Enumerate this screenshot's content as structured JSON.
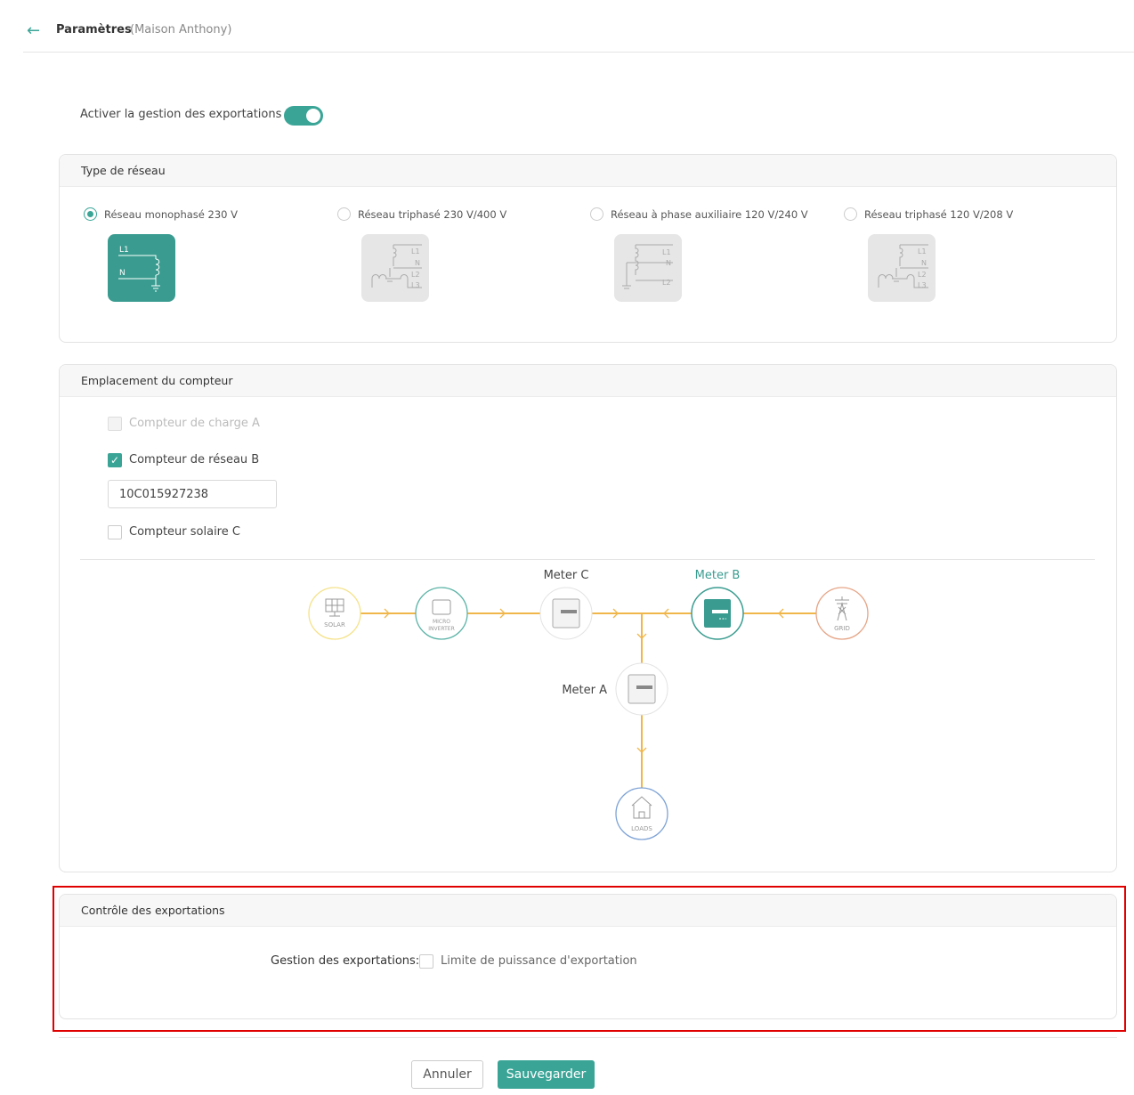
{
  "header": {
    "title": "Paramètres",
    "subtitle": "(Maison Anthony)"
  },
  "export_toggle": {
    "label": "Activer la gestion des exportations ?",
    "on": true
  },
  "network": {
    "title": "Type de réseau",
    "options": [
      {
        "label": "Réseau monophasé 230 V",
        "selected": true
      },
      {
        "label": "Réseau triphasé 230 V/400 V",
        "selected": false
      },
      {
        "label": "Réseau à phase auxiliaire 120 V/240 V",
        "selected": false
      },
      {
        "label": "Réseau triphasé 120 V/208 V",
        "selected": false
      }
    ]
  },
  "meter": {
    "title": "Emplacement du compteur",
    "load_a": {
      "label": "Compteur de charge A",
      "checked": false,
      "disabled": true
    },
    "grid_b": {
      "label": "Compteur de réseau B",
      "checked": true,
      "value": "10C015927238"
    },
    "solar_c": {
      "label": "Compteur solaire C",
      "checked": false
    },
    "diagram": {
      "solar": "SOLAR",
      "micro1": "MICRO",
      "micro2": "INVERTER",
      "grid": "GRID",
      "loads": "LOADS",
      "meter_c": "Meter C",
      "meter_b": "Meter B",
      "meter_a": "Meter A"
    }
  },
  "export_control": {
    "title": "Contrôle des exportations",
    "label": "Gestion des exportations:",
    "option": "Limite de puissance d'exportation",
    "checked": false
  },
  "buttons": {
    "cancel": "Annuler",
    "save": "Sauvegarder"
  },
  "colors": {
    "accent": "#3aa597",
    "line": "#f0b64a",
    "highlight": "#e00000"
  }
}
